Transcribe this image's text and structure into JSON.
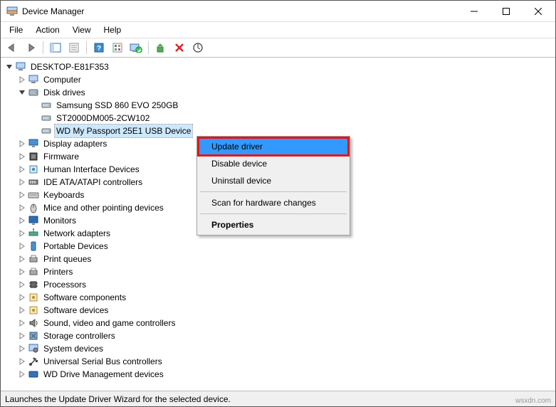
{
  "window": {
    "title": "Device Manager"
  },
  "menubar": [
    "File",
    "Action",
    "View",
    "Help"
  ],
  "toolbar_icons": [
    "back",
    "forward",
    "sep",
    "up-list",
    "properties",
    "sep",
    "help",
    "options",
    "monitor-refresh",
    "sep",
    "add",
    "remove",
    "scan"
  ],
  "tree": {
    "root": {
      "label": "DESKTOP-E81F353",
      "icon": "computer"
    },
    "nodes": [
      {
        "label": "Computer",
        "icon": "computer",
        "expanded": false
      },
      {
        "label": "Disk drives",
        "icon": "disk",
        "expanded": true,
        "children": [
          {
            "label": "Samsung SSD 860 EVO 250GB",
            "icon": "disk-small"
          },
          {
            "label": "ST2000DM005-2CW102",
            "icon": "disk-small"
          },
          {
            "label": "WD My Passport 25E1 USB Device",
            "icon": "disk-small",
            "selected": true
          }
        ]
      },
      {
        "label": "Display adapters",
        "icon": "display",
        "expanded": false
      },
      {
        "label": "Firmware",
        "icon": "chip",
        "expanded": false
      },
      {
        "label": "Human Interface Devices",
        "icon": "hid",
        "expanded": false
      },
      {
        "label": "IDE ATA/ATAPI controllers",
        "icon": "ide",
        "expanded": false
      },
      {
        "label": "Keyboards",
        "icon": "keyboard",
        "expanded": false
      },
      {
        "label": "Mice and other pointing devices",
        "icon": "mouse",
        "expanded": false
      },
      {
        "label": "Monitors",
        "icon": "monitor",
        "expanded": false
      },
      {
        "label": "Network adapters",
        "icon": "network",
        "expanded": false
      },
      {
        "label": "Portable Devices",
        "icon": "portable",
        "expanded": false
      },
      {
        "label": "Print queues",
        "icon": "printer",
        "expanded": false
      },
      {
        "label": "Printers",
        "icon": "printer",
        "expanded": false
      },
      {
        "label": "Processors",
        "icon": "cpu",
        "expanded": false
      },
      {
        "label": "Software components",
        "icon": "software",
        "expanded": false
      },
      {
        "label": "Software devices",
        "icon": "software",
        "expanded": false
      },
      {
        "label": "Sound, video and game controllers",
        "icon": "sound",
        "expanded": false
      },
      {
        "label": "Storage controllers",
        "icon": "storage",
        "expanded": false
      },
      {
        "label": "System devices",
        "icon": "system",
        "expanded": false
      },
      {
        "label": "Universal Serial Bus controllers",
        "icon": "usb",
        "expanded": false
      },
      {
        "label": "WD Drive Management devices",
        "icon": "wd",
        "expanded": false
      }
    ]
  },
  "context_menu": {
    "items": [
      {
        "label": "Update driver",
        "highlight": true
      },
      {
        "label": "Disable device"
      },
      {
        "label": "Uninstall device"
      },
      {
        "sep": true
      },
      {
        "label": "Scan for hardware changes"
      },
      {
        "sep": true
      },
      {
        "label": "Properties",
        "bold": true
      }
    ]
  },
  "statusbar": {
    "text": "Launches the Update Driver Wizard for the selected device."
  },
  "watermark": "wsxdn.com"
}
